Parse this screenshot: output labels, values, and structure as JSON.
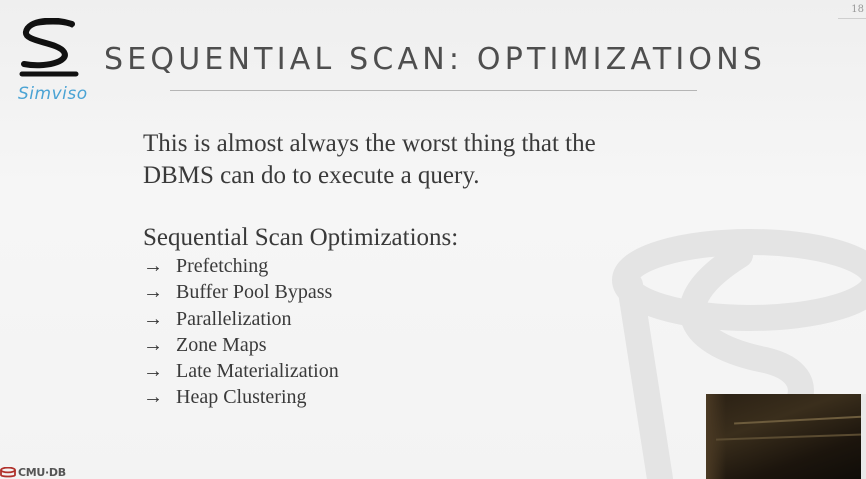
{
  "slide": {
    "page_number": "18"
  },
  "logo": {
    "brand_text": "Simviso",
    "accent_color": "#4aa3d4"
  },
  "title": "SEQUENTIAL SCAN: OPTIMIZATIONS",
  "content": {
    "intro_line1": "This is almost always the worst thing that the",
    "intro_line2": "DBMS can do to execute a query.",
    "subheading": "Sequential Scan Optimizations:",
    "arrow": "→",
    "items": [
      "Prefetching",
      "Buffer Pool Bypass",
      "Parallelization",
      "Zone Maps",
      "Late Materialization",
      "Heap Clustering"
    ]
  },
  "footer": {
    "logo_text": "CMU·DB",
    "logo_color": "#b0312b"
  }
}
